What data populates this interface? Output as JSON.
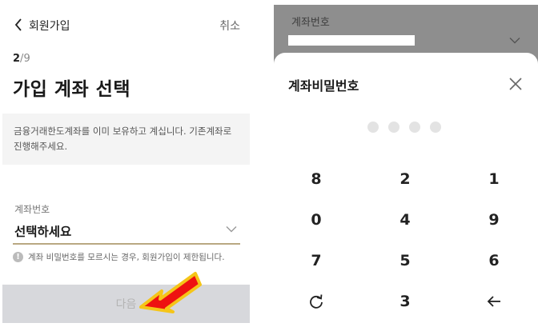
{
  "left_screen": {
    "header": {
      "title": "회원가입",
      "cancel_label": "취소",
      "back_icon": "chevron-left-icon"
    },
    "step": {
      "current": "2",
      "separator": "/",
      "total": "9"
    },
    "heading": "가입 계좌 선택",
    "notice_line1": "금융거래한도계좌를 이미 보유하고 계십니다. 기존계좌로",
    "notice_line2": "진행해주세요.",
    "account_field": {
      "label": "계좌번호",
      "value": "선택하세요",
      "chevron_icon": "chevron-down-icon",
      "underline_color": "#b9a882"
    },
    "warning": {
      "icon": "info-icon",
      "icon_glyph": "!",
      "text": "계좌 비밀번호를 모르시는 경우, 회원가입이 제한됩니다."
    },
    "next_button": {
      "label": "다음",
      "background": "#d7d8dc",
      "text_color": "#b4b4b4"
    },
    "annotation": {
      "icon": "red-arrow-icon",
      "fill": "#ee1111",
      "stroke": "#f5c518"
    }
  },
  "right_screen": {
    "dimmed_background": {
      "label": "계좌번호",
      "chevron_icon": "chevron-down-icon"
    },
    "pin_sheet": {
      "title": "계좌비밀번호",
      "close_icon": "close-icon",
      "pin_length": 4,
      "keys": [
        [
          "8",
          "2",
          "1"
        ],
        [
          "0",
          "4",
          "9"
        ],
        [
          "7",
          "5",
          "6"
        ],
        [
          "refresh-icon",
          "3",
          "backspace-icon"
        ]
      ]
    }
  }
}
